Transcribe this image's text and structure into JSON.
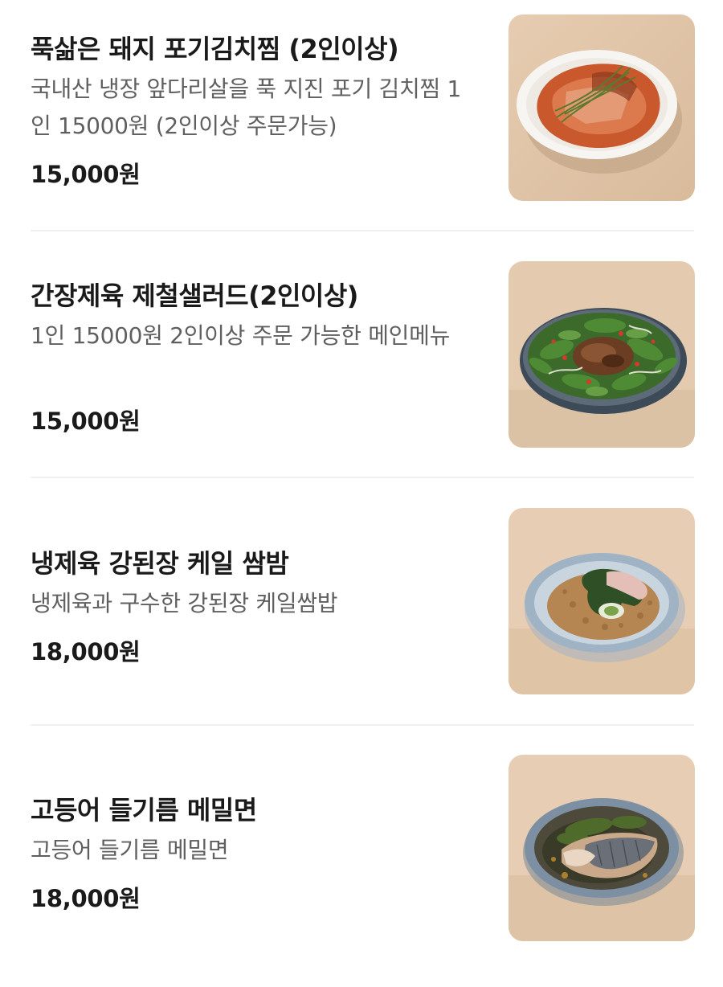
{
  "menu": {
    "items": [
      {
        "name": "푹삶은 돼지 포기김치찜 (2인이상)",
        "description": "국내산 냉장 앞다리살을 푹 지진 포기 김치찜 1인 15000원 (2인이상 주문가능)",
        "price": "15,000원",
        "image": "kimchi-jjim-photo"
      },
      {
        "name": "간장제육 제철샐러드(2인이상)",
        "description": "1인 15000원 2인이상 주문 가능한 메인메뉴",
        "price": "15,000원",
        "image": "jeyuk-salad-photo"
      },
      {
        "name": "냉제육 강된장 케일 쌈밤",
        "description": "냉제육과 구수한 강된장 케일쌈밥",
        "price": "18,000원",
        "image": "kale-ssambap-photo"
      },
      {
        "name": "고등어 들기름 메밀면",
        "description": "고등어 들기름 메밀면",
        "price": "18,000원",
        "image": "mackerel-noodle-photo"
      }
    ]
  },
  "colors": {
    "title": "#1a1a1a",
    "description": "#5f5f5f",
    "divider": "#f0f0f0",
    "photo_background": "#e2c8ac"
  }
}
